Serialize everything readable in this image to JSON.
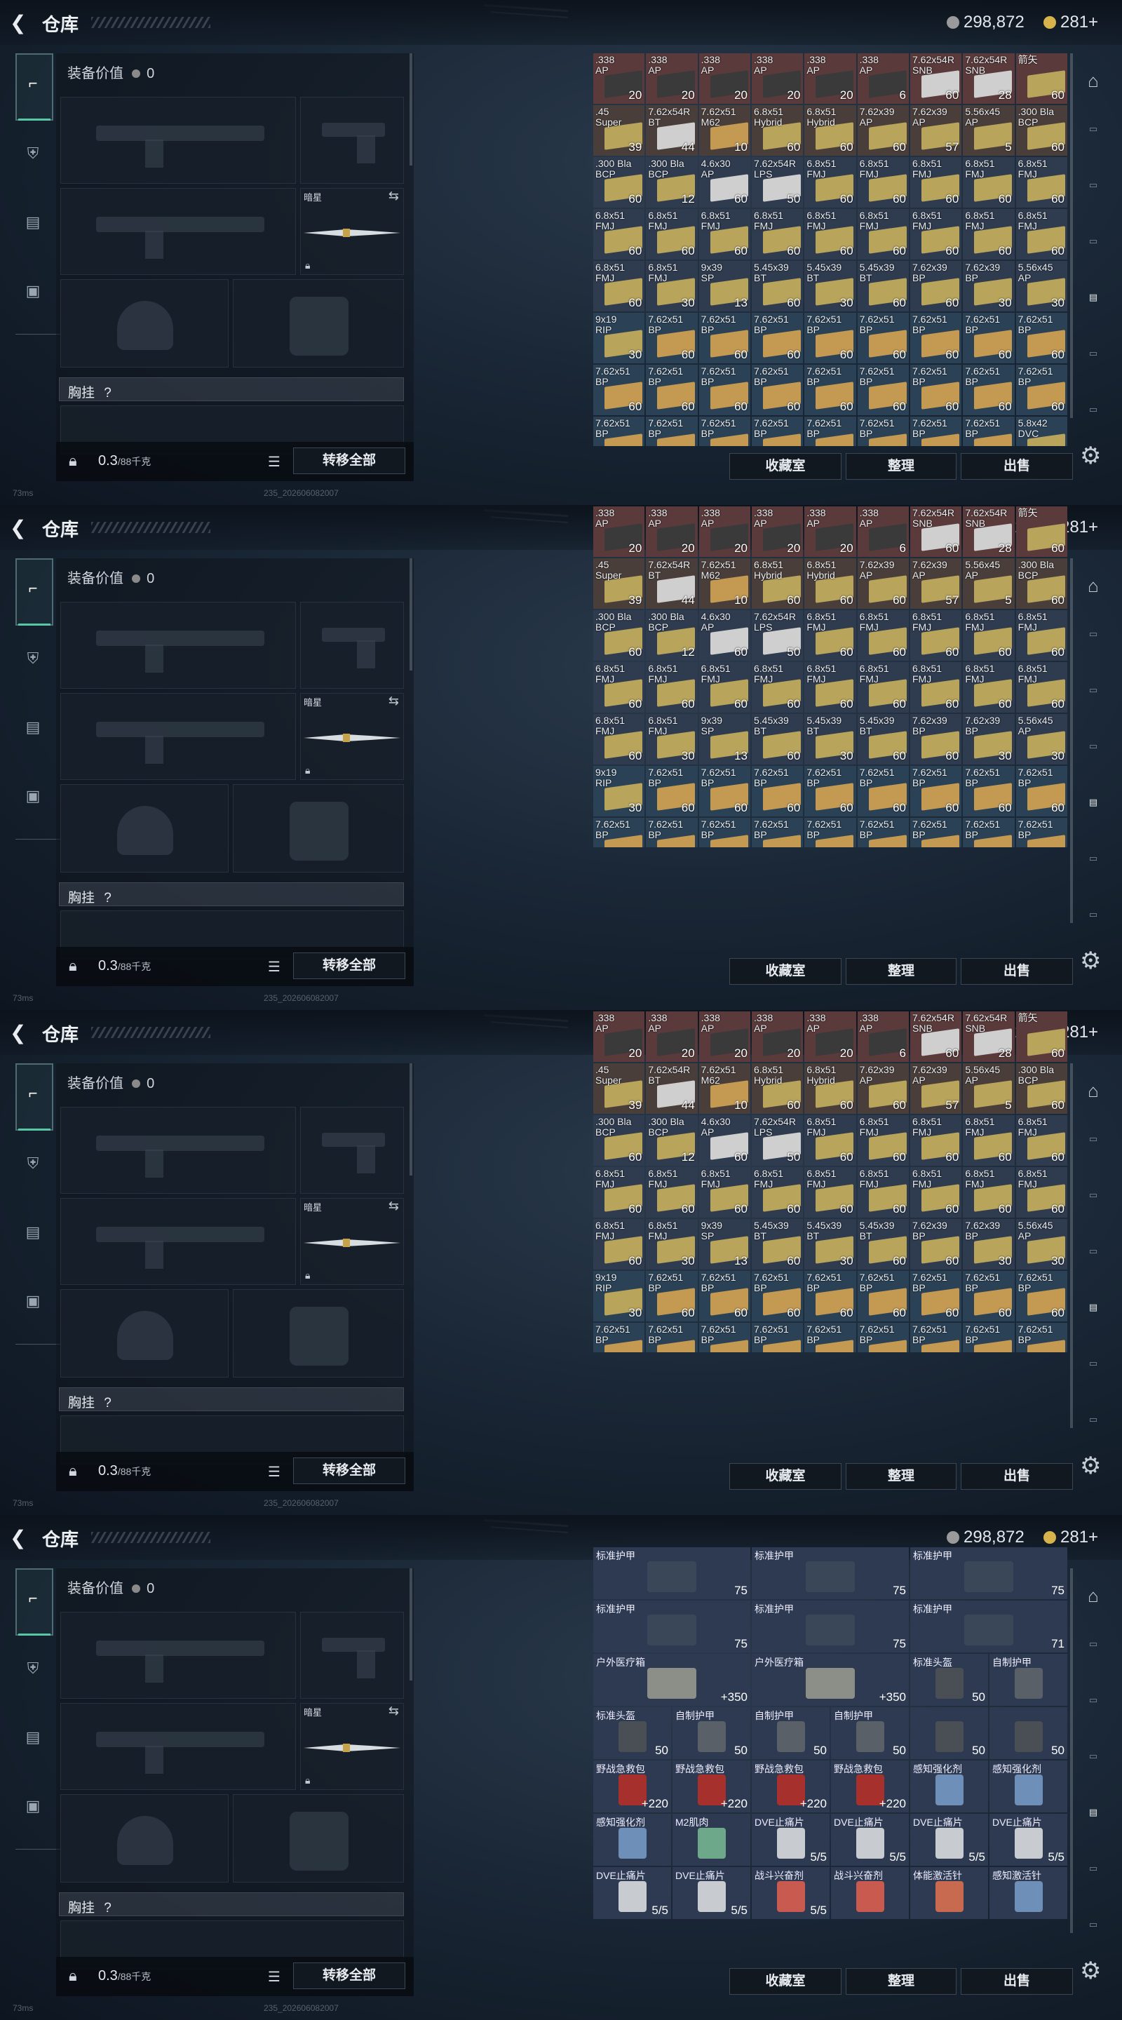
{
  "app": {
    "title": "仓库",
    "back_icon": "back-arrow-icon"
  },
  "currency": {
    "silver": "298,872",
    "gold": "281+",
    "silver_color": "#9a9a9a",
    "gold_color": "#d8b24a"
  },
  "equipment": {
    "value_label": "装备价值",
    "value": "0",
    "melee_name": "暗星",
    "chest_label": "胸挂",
    "chest_hint": "?",
    "weight": "0.3",
    "weight_max": "/88千克",
    "transfer_all": "转移全部"
  },
  "actions": {
    "collection": "收藏室",
    "sort": "整理",
    "sell": "出售"
  },
  "footer": {
    "ping": "73ms",
    "build": "235_202606082007"
  },
  "ammo_panel1": [
    {
      "n": ".338\nAP",
      "q": "20",
      "c": "#5a3a3a"
    },
    {
      "n": ".338\nAP",
      "q": "20",
      "c": "#5a3a3a"
    },
    {
      "n": ".338\nAP",
      "q": "20",
      "c": "#5a3a3a"
    },
    {
      "n": ".338\nAP",
      "q": "20",
      "c": "#5a3a3a"
    },
    {
      "n": ".338\nAP",
      "q": "20",
      "c": "#5a3a3a"
    },
    {
      "n": ".338\nAP",
      "q": "6",
      "c": "#5a3a3a"
    },
    {
      "n": "7.62x54R\nSNB",
      "q": "60",
      "c": "#5a3a3a"
    },
    {
      "n": "7.62x54R\nSNB",
      "q": "28",
      "c": "#5a3a3a"
    },
    {
      "n": "箭矢",
      "q": "60",
      "c": "#5a3a3a"
    },
    {
      "n": ".45\nSuper",
      "q": "39",
      "c": "#4a3e3a"
    },
    {
      "n": "7.62x54R\nBT",
      "q": "44",
      "c": "#4a3e3a"
    },
    {
      "n": "7.62x51\nM62",
      "q": "10",
      "c": "#4a3e3a"
    },
    {
      "n": "6.8x51\nHybrid",
      "q": "60",
      "c": "#4a3e3a"
    },
    {
      "n": "6.8x51\nHybrid",
      "q": "60",
      "c": "#4a3e3a"
    },
    {
      "n": "7.62x39\nAP",
      "q": "60",
      "c": "#4a3e3a"
    },
    {
      "n": "7.62x39\nAP",
      "q": "57",
      "c": "#4a3e3a"
    },
    {
      "n": "5.56x45\nAP",
      "q": "5",
      "c": "#4a3e3a"
    },
    {
      "n": ".300 Bla\nBCP",
      "q": "60",
      "c": "#4a3e3a"
    },
    {
      "n": ".300 Bla\nBCP",
      "q": "60",
      "c": "#2f3b4e"
    },
    {
      "n": ".300 Bla\nBCP",
      "q": "12",
      "c": "#2f3b4e"
    },
    {
      "n": "4.6x30\nAP",
      "q": "60",
      "c": "#2f3b4e"
    },
    {
      "n": "7.62x54R\nLPS",
      "q": "50",
      "c": "#2f3b4e"
    },
    {
      "n": "6.8x51\nFMJ",
      "q": "60",
      "c": "#2f3b4e"
    },
    {
      "n": "6.8x51\nFMJ",
      "q": "60",
      "c": "#2f3b4e"
    },
    {
      "n": "6.8x51\nFMJ",
      "q": "60",
      "c": "#2f3b4e"
    },
    {
      "n": "6.8x51\nFMJ",
      "q": "60",
      "c": "#2f3b4e"
    },
    {
      "n": "6.8x51\nFMJ",
      "q": "60",
      "c": "#2f3b4e"
    },
    {
      "n": "6.8x51\nFMJ",
      "q": "60",
      "c": "#2f3b4e"
    },
    {
      "n": "6.8x51\nFMJ",
      "q": "60",
      "c": "#2f3b4e"
    },
    {
      "n": "6.8x51\nFMJ",
      "q": "60",
      "c": "#2f3b4e"
    },
    {
      "n": "6.8x51\nFMJ",
      "q": "60",
      "c": "#2f3b4e"
    },
    {
      "n": "6.8x51\nFMJ",
      "q": "60",
      "c": "#2f3b4e"
    },
    {
      "n": "6.8x51\nFMJ",
      "q": "60",
      "c": "#2f3b4e"
    },
    {
      "n": "6.8x51\nFMJ",
      "q": "60",
      "c": "#2f3b4e"
    },
    {
      "n": "6.8x51\nFMJ",
      "q": "60",
      "c": "#2f3b4e"
    },
    {
      "n": "6.8x51\nFMJ",
      "q": "60",
      "c": "#2f3b4e"
    },
    {
      "n": "6.8x51\nFMJ",
      "q": "60",
      "c": "#2f3b4e"
    },
    {
      "n": "6.8x51\nFMJ",
      "q": "30",
      "c": "#2f3b4e"
    },
    {
      "n": "9x39\nSP",
      "q": "13",
      "c": "#2f3b4e"
    },
    {
      "n": "5.45x39\nBT",
      "q": "60",
      "c": "#2f3b4e"
    },
    {
      "n": "5.45x39\nBT",
      "q": "30",
      "c": "#2f3b4e"
    },
    {
      "n": "5.45x39\nBT",
      "q": "60",
      "c": "#2f3b4e"
    },
    {
      "n": "7.62x39\nBP",
      "q": "60",
      "c": "#2f3b4e"
    },
    {
      "n": "7.62x39\nBP",
      "q": "30",
      "c": "#2f3b4e"
    },
    {
      "n": "5.56x45\nAP",
      "q": "30",
      "c": "#2f3b4e"
    },
    {
      "n": "9x19\nRIP",
      "q": "30",
      "c": "#2b4256"
    },
    {
      "n": "7.62x51\nBP",
      "q": "60",
      "c": "#2b4256"
    },
    {
      "n": "7.62x51\nBP",
      "q": "60",
      "c": "#2b4256"
    },
    {
      "n": "7.62x51\nBP",
      "q": "60",
      "c": "#2b4256"
    },
    {
      "n": "7.62x51\nBP",
      "q": "60",
      "c": "#2b4256"
    },
    {
      "n": "7.62x51\nBP",
      "q": "60",
      "c": "#2b4256"
    },
    {
      "n": "7.62x51\nBP",
      "q": "60",
      "c": "#2b4256"
    },
    {
      "n": "7.62x51\nBP",
      "q": "60",
      "c": "#2b4256"
    },
    {
      "n": "7.62x51\nBP",
      "q": "60",
      "c": "#2b4256"
    },
    {
      "n": "7.62x51\nBP",
      "q": "60",
      "c": "#2b4256"
    },
    {
      "n": "7.62x51\nBP",
      "q": "60",
      "c": "#2b4256"
    },
    {
      "n": "7.62x51\nBP",
      "q": "60",
      "c": "#2b4256"
    },
    {
      "n": "7.62x51\nBP",
      "q": "60",
      "c": "#2b4256"
    },
    {
      "n": "7.62x51\nBP",
      "q": "60",
      "c": "#2b4256"
    },
    {
      "n": "7.62x51\nBP",
      "q": "60",
      "c": "#2b4256"
    },
    {
      "n": "7.62x51\nBP",
      "q": "60",
      "c": "#2b4256"
    },
    {
      "n": "7.62x51\nBP",
      "q": "60",
      "c": "#2b4256"
    },
    {
      "n": "7.62x51\nBP",
      "q": "60",
      "c": "#2b4256"
    },
    {
      "n": "7.62x51\nBP",
      "q": "",
      "c": "#2b4256"
    },
    {
      "n": "7.62x51\nBP",
      "q": "",
      "c": "#2b4256"
    },
    {
      "n": "7.62x51\nBP",
      "q": "",
      "c": "#2b4256"
    },
    {
      "n": "7.62x51\nBP",
      "q": "",
      "c": "#2b4256"
    },
    {
      "n": "7.62x51\nBP",
      "q": "",
      "c": "#2b4256"
    },
    {
      "n": "7.62x51\nBP",
      "q": "",
      "c": "#2b4256"
    },
    {
      "n": "7.62x51\nBP",
      "q": "",
      "c": "#2b4256"
    },
    {
      "n": "7.62x51\nBP",
      "q": "",
      "c": "#2b4256"
    },
    {
      "n": "5.8x42\nDVC",
      "q": "",
      "c": "#2b4256"
    }
  ],
  "gear_panel": [
    {
      "n": "标准护甲",
      "q": "75",
      "span": 2
    },
    {
      "n": "标准护甲",
      "q": "75",
      "span": 2
    },
    {
      "n": "标准护甲",
      "q": "75",
      "span": 2
    },
    {
      "n": "标准护甲",
      "q": "75",
      "span": 2
    },
    {
      "n": "标准护甲",
      "q": "75",
      "span": 2
    },
    {
      "n": "标准护甲",
      "q": "71",
      "span": 2
    },
    {
      "n": "户外医疗箱",
      "q": "+350",
      "span": 2
    },
    {
      "n": "户外医疗箱",
      "q": "+350",
      "span": 2
    },
    {
      "n": "标准头盔",
      "q": "50",
      "span": 1
    },
    {
      "n": "自制护甲",
      "q": "",
      "span": 1
    },
    {
      "n": "标准头盔",
      "q": "50",
      "span": 1
    },
    {
      "n": "自制护甲",
      "q": "50",
      "span": 1
    },
    {
      "n": "自制护甲",
      "q": "50",
      "span": 1
    },
    {
      "n": "自制护甲",
      "q": "50",
      "span": 1
    },
    {
      "n": "",
      "q": "50",
      "span": 1
    },
    {
      "n": "",
      "q": "50",
      "span": 1
    },
    {
      "n": "野战急救包",
      "q": "+220",
      "span": 1
    },
    {
      "n": "野战急救包",
      "q": "+220",
      "span": 1
    },
    {
      "n": "野战急救包",
      "q": "+220",
      "span": 1
    },
    {
      "n": "野战急救包",
      "q": "+220",
      "span": 1
    },
    {
      "n": "感知强化剂",
      "q": "",
      "span": 1
    },
    {
      "n": "感知强化剂",
      "q": "",
      "span": 1
    },
    {
      "n": "感知强化剂",
      "q": "",
      "span": 1
    },
    {
      "n": "M2肌肉",
      "q": "",
      "span": 1
    },
    {
      "n": "DVE止痛片",
      "q": "5/5",
      "span": 1
    },
    {
      "n": "DVE止痛片",
      "q": "5/5",
      "span": 1
    },
    {
      "n": "DVE止痛片",
      "q": "5/5",
      "span": 1
    },
    {
      "n": "DVE止痛片",
      "q": "5/5",
      "span": 1
    },
    {
      "n": "DVE止痛片",
      "q": "5/5",
      "span": 1
    },
    {
      "n": "DVE止痛片",
      "q": "5/5",
      "span": 1
    },
    {
      "n": "战斗兴奋剂",
      "q": "5/5",
      "span": 1
    },
    {
      "n": "战斗兴奋剂",
      "q": "",
      "span": 1
    },
    {
      "n": "体能激活针",
      "q": "",
      "span": 1
    },
    {
      "n": "感知激活针",
      "q": "",
      "span": 1
    }
  ]
}
